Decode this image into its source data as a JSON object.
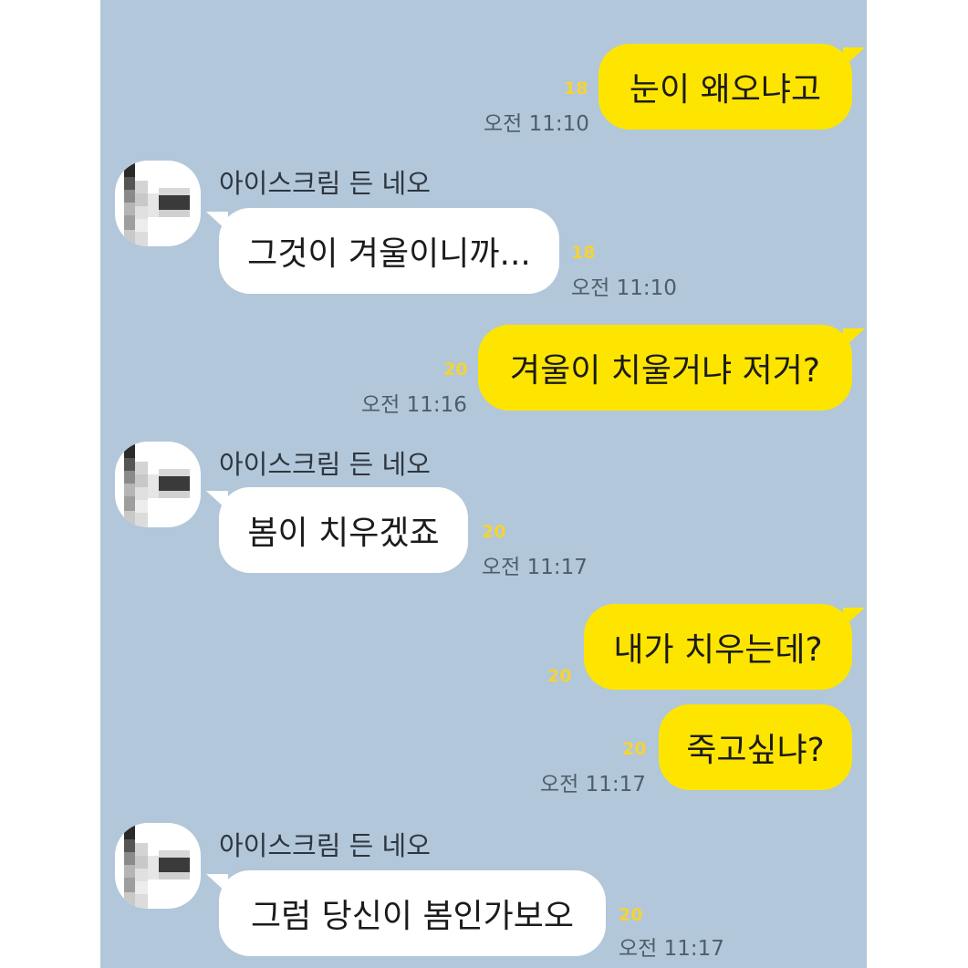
{
  "colors": {
    "chat_background": "#b2c7d9",
    "my_bubble": "#fee500",
    "other_bubble": "#ffffff",
    "unread_count": "#f5d335",
    "timestamp": "#4e5d6a"
  },
  "avatar_icon": "pixelated-profile-icon",
  "messages": [
    {
      "from": "me",
      "text": "눈이 왜오냐고",
      "unread": "18",
      "time": "오전 11:10"
    },
    {
      "from": "other",
      "sender": "아이스크림 든 네오",
      "text": "그것이 겨울이니까...",
      "unread": "18",
      "time": "오전 11:10"
    },
    {
      "from": "me",
      "text": "겨울이 치울거냐 저거?",
      "unread": "20",
      "time": "오전 11:16"
    },
    {
      "from": "other",
      "sender": "아이스크림 든 네오",
      "text": "봄이 치우겠죠",
      "unread": "20",
      "time": "오전 11:17"
    },
    {
      "from": "me",
      "text": "내가 치우는데?",
      "unread": "20",
      "time": ""
    },
    {
      "from": "me",
      "text": "죽고싶냐?",
      "unread": "20",
      "time": "오전 11:17"
    },
    {
      "from": "other",
      "sender": "아이스크림 든 네오",
      "text": "그럼 당신이 봄인가보오",
      "unread": "20",
      "time": "오전 11:17"
    }
  ]
}
